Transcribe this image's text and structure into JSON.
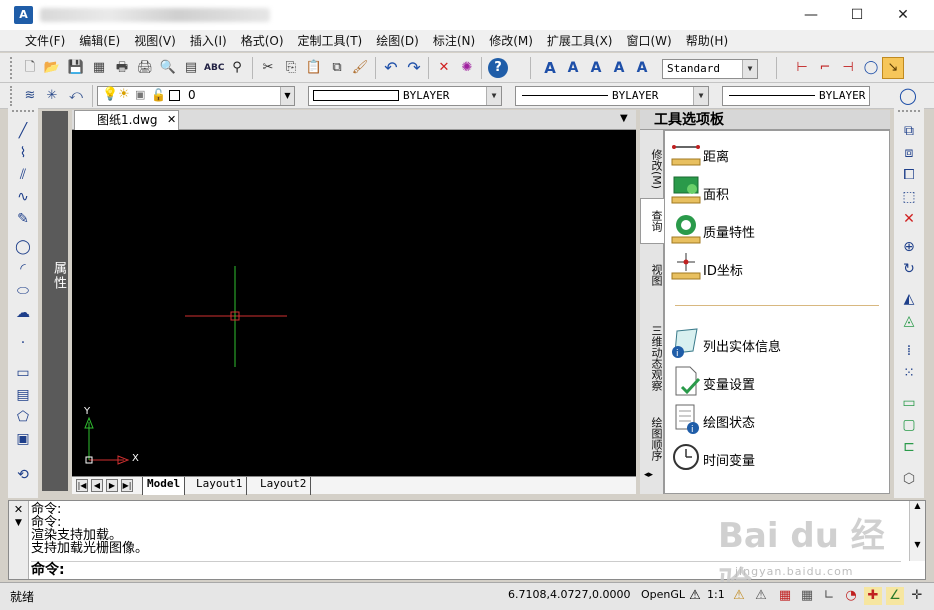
{
  "app": {
    "logo_text": "A"
  },
  "window_controls": {
    "minimize": "—",
    "maximize": "☐",
    "close": "✕"
  },
  "menu": [
    "文件(F)",
    "编辑(E)",
    "视图(V)",
    "插入(I)",
    "格式(O)",
    "定制工具(T)",
    "绘图(D)",
    "标注(N)",
    "修改(M)",
    "扩展工具(X)",
    "窗口(W)",
    "帮助(H)"
  ],
  "toolbar": {
    "text_style": "Standard",
    "layer": "0",
    "color": "BYLAYER",
    "linetype": "BYLAYER",
    "lineweight": "BYLAYER"
  },
  "properties_panel": {
    "label": "属性"
  },
  "document": {
    "tab_name": "图纸1.dwg",
    "close": "✕"
  },
  "layout_tabs": [
    "Model",
    "Layout1",
    "Layout2"
  ],
  "ucs": {
    "y_label": "Y",
    "x_label": "X"
  },
  "tool_palette": {
    "title": "工具选项板",
    "tabs": [
      "修改(M)",
      "查询",
      "视图",
      "三维动态观察",
      "绘图顺序"
    ],
    "items_top": [
      "距离",
      "面积",
      "质量特性",
      "ID坐标"
    ],
    "items_bottom": [
      "列出实体信息",
      "变量设置",
      "绘图状态",
      "时间变量"
    ]
  },
  "command_line": {
    "history": [
      "命令:",
      "命令:",
      "渲染支持加载。",
      "支持加载光栅图像。"
    ],
    "prompt": "命令:"
  },
  "status_bar": {
    "status": "就绪",
    "coordinates": "6.7108,4.0727,0.0000",
    "renderer": "OpenGL",
    "scale": "1:1"
  },
  "watermark": {
    "text": "Bai du 经验",
    "url": "jingyan.baidu.com"
  },
  "colors": {
    "canvas": "#000000",
    "crosshair_x": "#d03030",
    "crosshair_y": "#30c030",
    "accent": "#1e3f8a"
  }
}
